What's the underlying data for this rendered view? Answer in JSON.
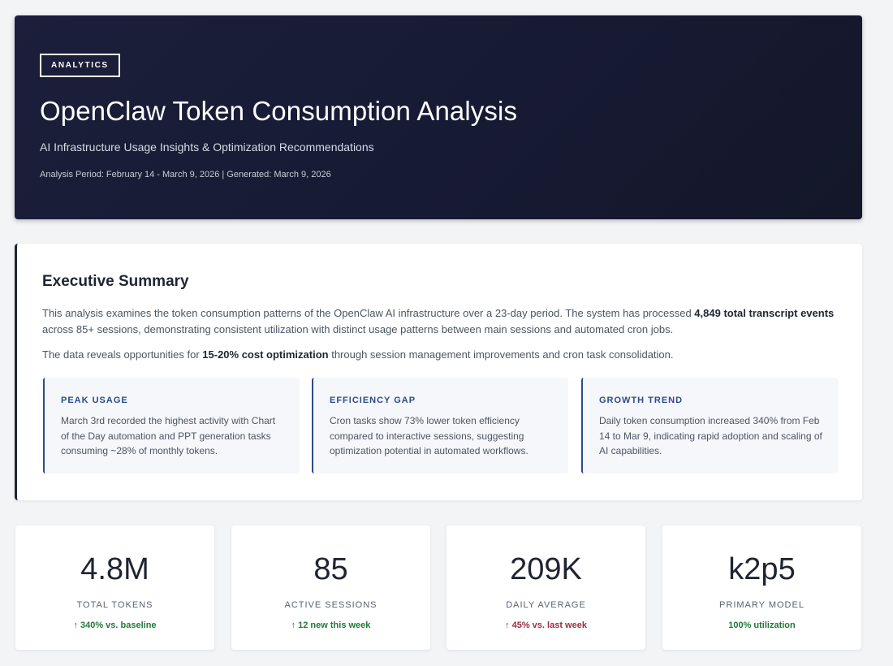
{
  "header": {
    "tag": "ANALYTICS",
    "title": "OpenClaw Token Consumption Analysis",
    "subtitle": "AI Infrastructure Usage Insights & Optimization Recommendations",
    "meta": "Analysis Period: February 14 - March 9, 2026 | Generated: March 9, 2026"
  },
  "summary": {
    "heading": "Executive Summary",
    "p1_before": "This analysis examines the token consumption patterns of the OpenClaw AI infrastructure over a 23-day period. The system has processed ",
    "p1_bold": "4,849 total transcript events",
    "p1_after": " across 85+ sessions, demonstrating consistent utilization with distinct usage patterns between main sessions and automated cron jobs.",
    "p2_before": "The data reveals opportunities for ",
    "p2_bold": "15-20% cost optimization",
    "p2_after": " through session management improvements and cron task consolidation.",
    "insights": [
      {
        "title": "PEAK USAGE",
        "text": "March 3rd recorded the highest activity with Chart of the Day automation and PPT generation tasks consuming ~28% of monthly tokens."
      },
      {
        "title": "EFFICIENCY GAP",
        "text": "Cron tasks show 73% lower token efficiency compared to interactive sessions, suggesting optimization potential in automated workflows."
      },
      {
        "title": "GROWTH TREND",
        "text": "Daily token consumption increased 340% from Feb 14 to Mar 9, indicating rapid adoption and scaling of AI capabilities."
      }
    ]
  },
  "stats": [
    {
      "value": "4.8M",
      "label": "TOTAL TOKENS",
      "change": "↑ 340% vs. baseline",
      "trend": "up"
    },
    {
      "value": "85",
      "label": "ACTIVE SESSIONS",
      "change": "↑ 12 new this week",
      "trend": "up"
    },
    {
      "value": "209K",
      "label": "DAILY AVERAGE",
      "change": "↑ 45% vs. last week",
      "trend": "down"
    },
    {
      "value": "k2p5",
      "label": "PRIMARY MODEL",
      "change": "100% utilization",
      "trend": "up"
    }
  ],
  "colors": {
    "hero_bg": "#1b1f3b",
    "accent_blue": "#2c4a8c",
    "positive": "#1f7a36",
    "negative": "#9b2d3c"
  }
}
